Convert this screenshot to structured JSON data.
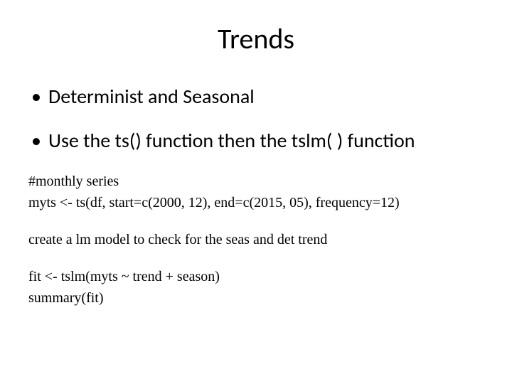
{
  "title": "Trends",
  "bullets": [
    "Determinist  and Seasonal",
    "Use the ts() function then the tslm( ) function"
  ],
  "body": {
    "line1": "#monthly series",
    "line2": "myts <- ts(df, start=c(2000, 12), end=c(2015, 05), frequency=12)",
    "line3": "create a lm model to check for the seas and det trend",
    "line4": "fit <- tslm(myts ~ trend + season)",
    "line5": "summary(fit)"
  }
}
